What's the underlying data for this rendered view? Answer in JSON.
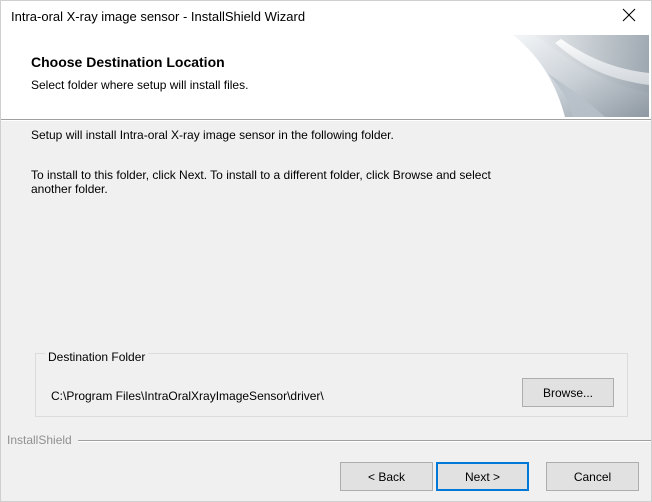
{
  "window": {
    "title": "Intra-oral X-ray image sensor - InstallShield Wizard",
    "close_icon": "close-icon"
  },
  "header": {
    "title": "Choose Destination Location",
    "subtitle": "Select folder where setup will install files.",
    "graphic_icon": "page-curl-graphic"
  },
  "body": {
    "line1": "Setup will install Intra-oral X-ray image sensor in the following folder.",
    "line2a": "To install to this folder, click Next. To install to a different folder, click Browse and select",
    "line2b": "another folder."
  },
  "destination": {
    "legend": "Destination Folder",
    "path": "C:\\Program Files\\IntraOralXrayImageSensor\\driver\\",
    "browse_label": "Browse..."
  },
  "footer": {
    "brand": "InstallShield",
    "back_label": "< Back",
    "next_label": "Next >",
    "cancel_label": "Cancel"
  },
  "colors": {
    "window_bg": "#f0f0f0",
    "header_bg": "#ffffff",
    "default_button_border": "#0078d7"
  }
}
